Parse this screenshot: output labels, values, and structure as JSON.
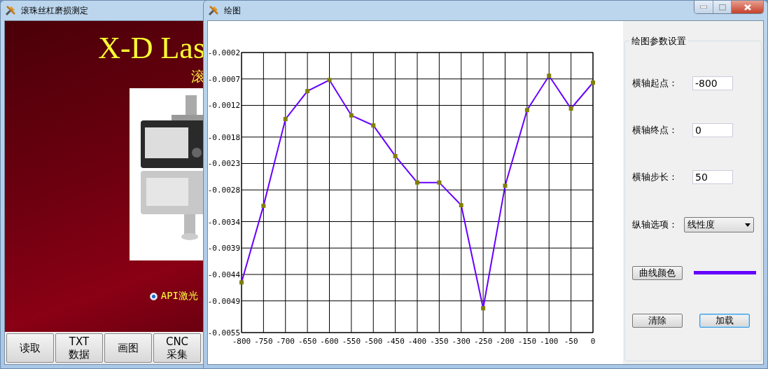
{
  "back_window": {
    "title": "滚珠丝杠磨损测定",
    "banner_title": "X-D Las",
    "banner_subtitle": "滚",
    "radio": {
      "label": "API激光",
      "selected": true
    },
    "buttons": [
      {
        "lines": [
          "读取"
        ]
      },
      {
        "lines": [
          "TXT",
          "数据"
        ]
      },
      {
        "lines": [
          "画图"
        ]
      },
      {
        "lines": [
          "CNC",
          "采集"
        ]
      }
    ]
  },
  "plot_window": {
    "title": "绘图",
    "chart_data": {
      "type": "line",
      "x": [
        -800,
        -750,
        -700,
        -650,
        -600,
        -550,
        -500,
        -450,
        -400,
        -350,
        -300,
        -250,
        -200,
        -150,
        -100,
        -50,
        0
      ],
      "grid": true,
      "series": [
        {
          "color": "#6600ff",
          "marker": "square",
          "values": [
            -0.00455,
            -0.0031,
            -0.00146,
            -0.00093,
            -0.00072,
            -0.00139,
            -0.00158,
            -0.00216,
            -0.00266,
            -0.00266,
            -0.00309,
            -0.00504,
            -0.00272,
            -0.00129,
            -0.00064,
            -0.00126,
            -0.00077
          ]
        }
      ],
      "xlim": [
        -800,
        0
      ],
      "ylim": [
        -0.0055,
        -0.0002
      ],
      "xticks": [
        -800,
        -750,
        -700,
        -650,
        -600,
        -550,
        -500,
        -450,
        -400,
        -350,
        -300,
        -250,
        -200,
        -150,
        -100,
        -50,
        0
      ],
      "yticks": [
        {
          "value": -0.0002,
          "label": "-0.0002"
        },
        {
          "value": -0.0007,
          "label": "-0.0007"
        },
        {
          "value": -0.0012,
          "label": "-0.0012"
        },
        {
          "value": -0.0018,
          "label": "-0.0018"
        },
        {
          "value": -0.0023,
          "label": "-0.0023"
        },
        {
          "value": -0.0028,
          "label": "-0.0028"
        },
        {
          "value": -0.0034,
          "label": "-0.0034"
        },
        {
          "value": -0.0039,
          "label": "-0.0039"
        },
        {
          "value": -0.0044,
          "label": "-0.0044"
        },
        {
          "value": -0.0049,
          "label": "-0.0049"
        },
        {
          "value": -0.0055,
          "label": "-0.0055"
        }
      ]
    },
    "settings": {
      "group_title": "绘图参数设置",
      "fields": [
        {
          "label": "横轴起点：",
          "value": "-800"
        },
        {
          "label": "横轴终点：",
          "value": "0"
        },
        {
          "label": "横轴步长：",
          "value": "50"
        }
      ],
      "vertical_axis": {
        "label": "纵轴选项：",
        "value": "线性度"
      },
      "color_button": {
        "label": "曲线颜色"
      },
      "buttons": [
        {
          "label": "清除",
          "focused": false
        },
        {
          "label": "加载",
          "focused": true
        }
      ]
    }
  }
}
